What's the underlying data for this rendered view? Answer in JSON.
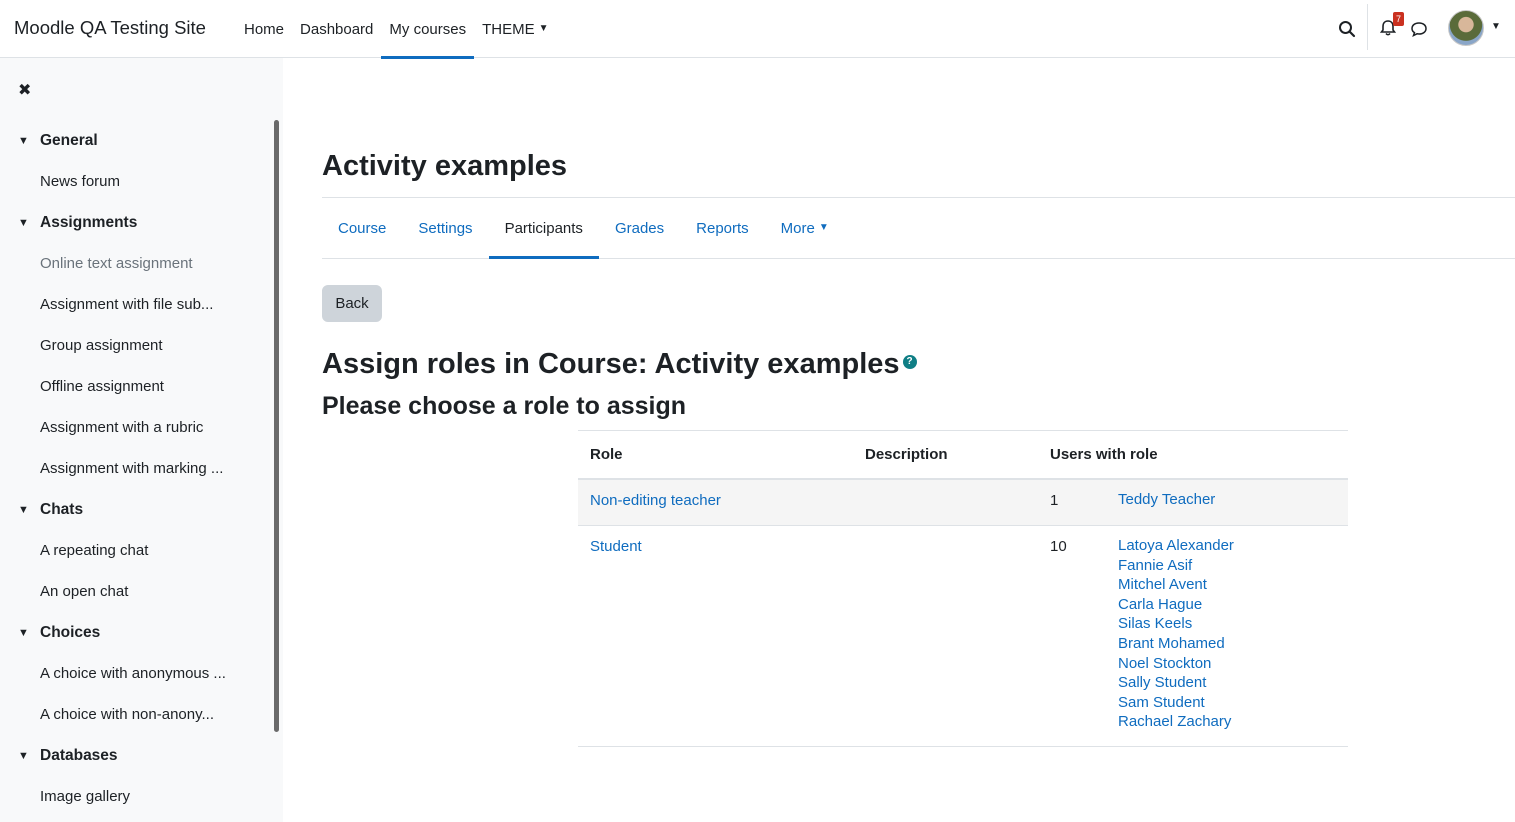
{
  "navbar": {
    "brand": "Moodle QA Testing Site",
    "items": [
      {
        "label": "Home"
      },
      {
        "label": "Dashboard"
      },
      {
        "label": "My courses"
      },
      {
        "label": "THEME"
      }
    ],
    "notification_count": "7"
  },
  "drawer": {
    "close_symbol": "✖",
    "sections": [
      {
        "title": "General",
        "items": [
          "News forum"
        ]
      },
      {
        "title": "Assignments",
        "items": [
          "Online text assignment",
          "Assignment with file sub...",
          "Group assignment",
          "Offline assignment",
          "Assignment with a rubric",
          "Assignment with marking ..."
        ]
      },
      {
        "title": "Chats",
        "items": [
          "A repeating chat",
          "An open chat"
        ]
      },
      {
        "title": "Choices",
        "items": [
          "A choice with anonymous ...",
          "A choice with non-anony..."
        ]
      },
      {
        "title": "Databases",
        "items": [
          "Image gallery"
        ]
      }
    ]
  },
  "page": {
    "title": "Activity examples",
    "tabs": [
      {
        "label": "Course"
      },
      {
        "label": "Settings"
      },
      {
        "label": "Participants"
      },
      {
        "label": "Grades"
      },
      {
        "label": "Reports"
      },
      {
        "label": "More"
      }
    ],
    "back_label": "Back",
    "assign_heading": "Assign roles in Course: Activity examples",
    "choose_heading": "Please choose a role to assign",
    "table": {
      "headers": {
        "role": "Role",
        "description": "Description",
        "users": "Users with role"
      },
      "rows": [
        {
          "role": "Non-editing teacher",
          "description": "",
          "count": "1",
          "users": [
            "Teddy Teacher"
          ]
        },
        {
          "role": "Student",
          "description": "",
          "count": "10",
          "users": [
            "Latoya Alexander",
            "Fannie Asif",
            "Mitchel Avent",
            "Carla Hague",
            "Silas Keels",
            "Brant Mohamed",
            "Noel Stockton",
            "Sally Student",
            "Sam Student",
            "Rachael Zachary"
          ]
        }
      ]
    }
  },
  "colors": {
    "link": "#0f6cbf",
    "active_underline": "#0f6cbf",
    "badge": "#ca3120",
    "help": "#0f7e85"
  }
}
